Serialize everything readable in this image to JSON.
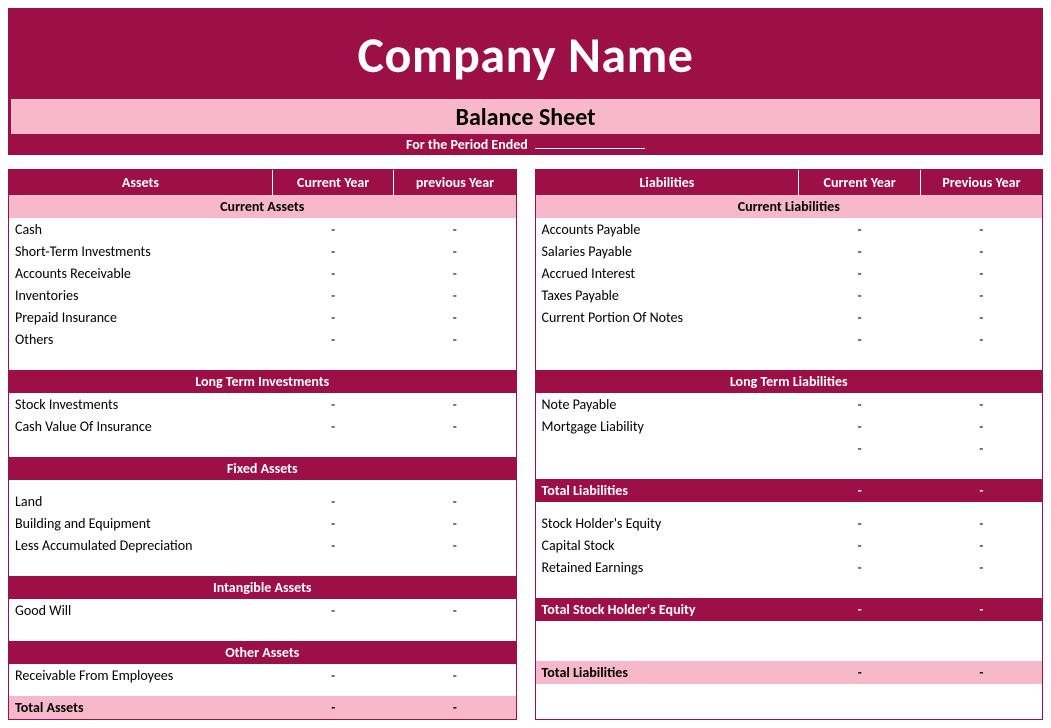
{
  "title": "Company Name",
  "subtitle": "Balance Sheet",
  "period_label": "For the Period Ended",
  "dash": "-",
  "left": {
    "headers": [
      "Assets",
      "Current Year",
      "previous Year"
    ],
    "sec_current": "Current Assets",
    "rows_current": [
      "Cash",
      "Short-Term Investments",
      "Accounts Receivable",
      "Inventories",
      "Prepaid Insurance",
      "Others"
    ],
    "sec_longterm": "Long Term Investments",
    "rows_longterm": [
      "Stock Investments",
      "Cash Value Of Insurance"
    ],
    "sec_fixed": "Fixed Assets",
    "rows_fixed": [
      "Land",
      "Building and Equipment",
      "Less Accumulated Depreciation"
    ],
    "sec_intangible": "Intangible Assets",
    "rows_intangible": [
      "Good Will"
    ],
    "sec_other": "Other Assets",
    "rows_other": [
      "Receivable From Employees"
    ],
    "total": "Total Assets"
  },
  "right": {
    "headers": [
      "Liabilities",
      "Current Year",
      "Previous Year"
    ],
    "sec_current": "Current Liabilities",
    "rows_current": [
      "Accounts Payable",
      "Salaries Payable",
      "Accrued Interest",
      "Taxes Payable",
      "Current Portion Of Notes"
    ],
    "sec_longterm": "Long Term Liabilities",
    "rows_longterm": [
      "Note Payable",
      "Mortgage Liability"
    ],
    "total_liab": "Total Liabilities",
    "rows_equity": [
      "Stock Holder's Equity",
      "Capital Stock",
      "Retained Earnings"
    ],
    "total_equity": "Total Stock Holder's Equity",
    "total_final": "Total Liabilities"
  }
}
